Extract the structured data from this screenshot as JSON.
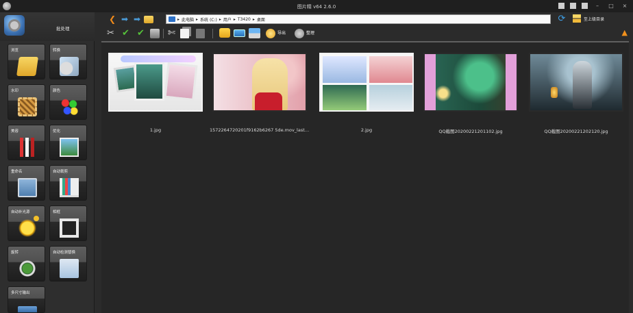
{
  "window": {
    "title": "图片精 v64 2.6.0",
    "controls": [
      "▣",
      "◫",
      "▬",
      "–",
      "□",
      "×"
    ]
  },
  "left_panel": {
    "title": "批处理",
    "tiles": [
      {
        "label": "浏览",
        "icon": "folder-image-icon"
      },
      {
        "label": "转换",
        "icon": "convert-icon"
      },
      {
        "label": "水印",
        "icon": "watermark-icon"
      },
      {
        "label": "颜色",
        "icon": "color-balls-icon"
      },
      {
        "label": "美容",
        "icon": "lipstick-icon"
      },
      {
        "label": "优化",
        "icon": "optimize-picture-icon"
      },
      {
        "label": "重命名",
        "icon": "rename-icon"
      },
      {
        "label": "自动裁剪",
        "icon": "auto-crop-icon"
      },
      {
        "label": "自动补光源",
        "icon": "light-bulb-icon"
      },
      {
        "label": "相框",
        "icon": "photo-frame-icon"
      },
      {
        "label": "旋转",
        "icon": "rotate-icon"
      },
      {
        "label": "自动检测替换",
        "icon": "people-swap-icon"
      },
      {
        "label": "多尺寸输出",
        "icon": "multi-size-icon"
      }
    ]
  },
  "nav": {
    "back": "❮",
    "forward": "➡",
    "forward2": "➡",
    "path": [
      "此电脑",
      "系统 (C:)",
      "用户",
      "T3420",
      "桌面"
    ],
    "separator": "▸",
    "refresh": "⟳",
    "parent_label": "至上级目录"
  },
  "toolbar": {
    "tools": "✂",
    "check1": "✔",
    "check2": "✔",
    "cut": "✄",
    "export_label": "导出",
    "organize_label": "整理",
    "collapse": "▲"
  },
  "files": [
    {
      "name": "1.jpg"
    },
    {
      "name": "1572264720201f9162b6267 5de.mov_last8..."
    },
    {
      "name": "2.jpg"
    },
    {
      "name": "QQ截图20200221201102.jpg"
    },
    {
      "name": "QQ截图20200221202120.jpg"
    }
  ],
  "colors": {
    "background": "#262626",
    "accent_orange": "#f08a1a",
    "accent_blue": "#3ea0e8",
    "check_green": "#56c23a"
  }
}
